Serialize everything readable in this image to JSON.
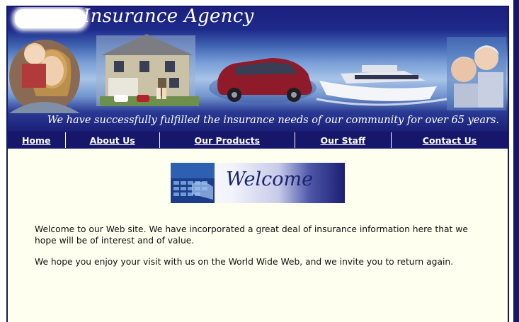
{
  "header": {
    "title": "Insurance Agency",
    "tagline": "We have successfully fulfilled the insurance needs of our community for over 65 years."
  },
  "nav": {
    "items": [
      {
        "label": "Home"
      },
      {
        "label": "About Us"
      },
      {
        "label": "Our Products"
      },
      {
        "label": "Our Staff"
      },
      {
        "label": "Contact Us"
      }
    ]
  },
  "main": {
    "welcome_heading": "Welcome",
    "paragraphs": [
      "Welcome to our Web site. We have incorporated a great deal of insurance information here that we hope will be of interest and of value.",
      "We hope you enjoy your visit with us on the World Wide Web, and we invite you to return again."
    ]
  },
  "colors": {
    "frame": "#16176a",
    "content_bg": "#fffff0",
    "nav_text": "#ffffff"
  }
}
